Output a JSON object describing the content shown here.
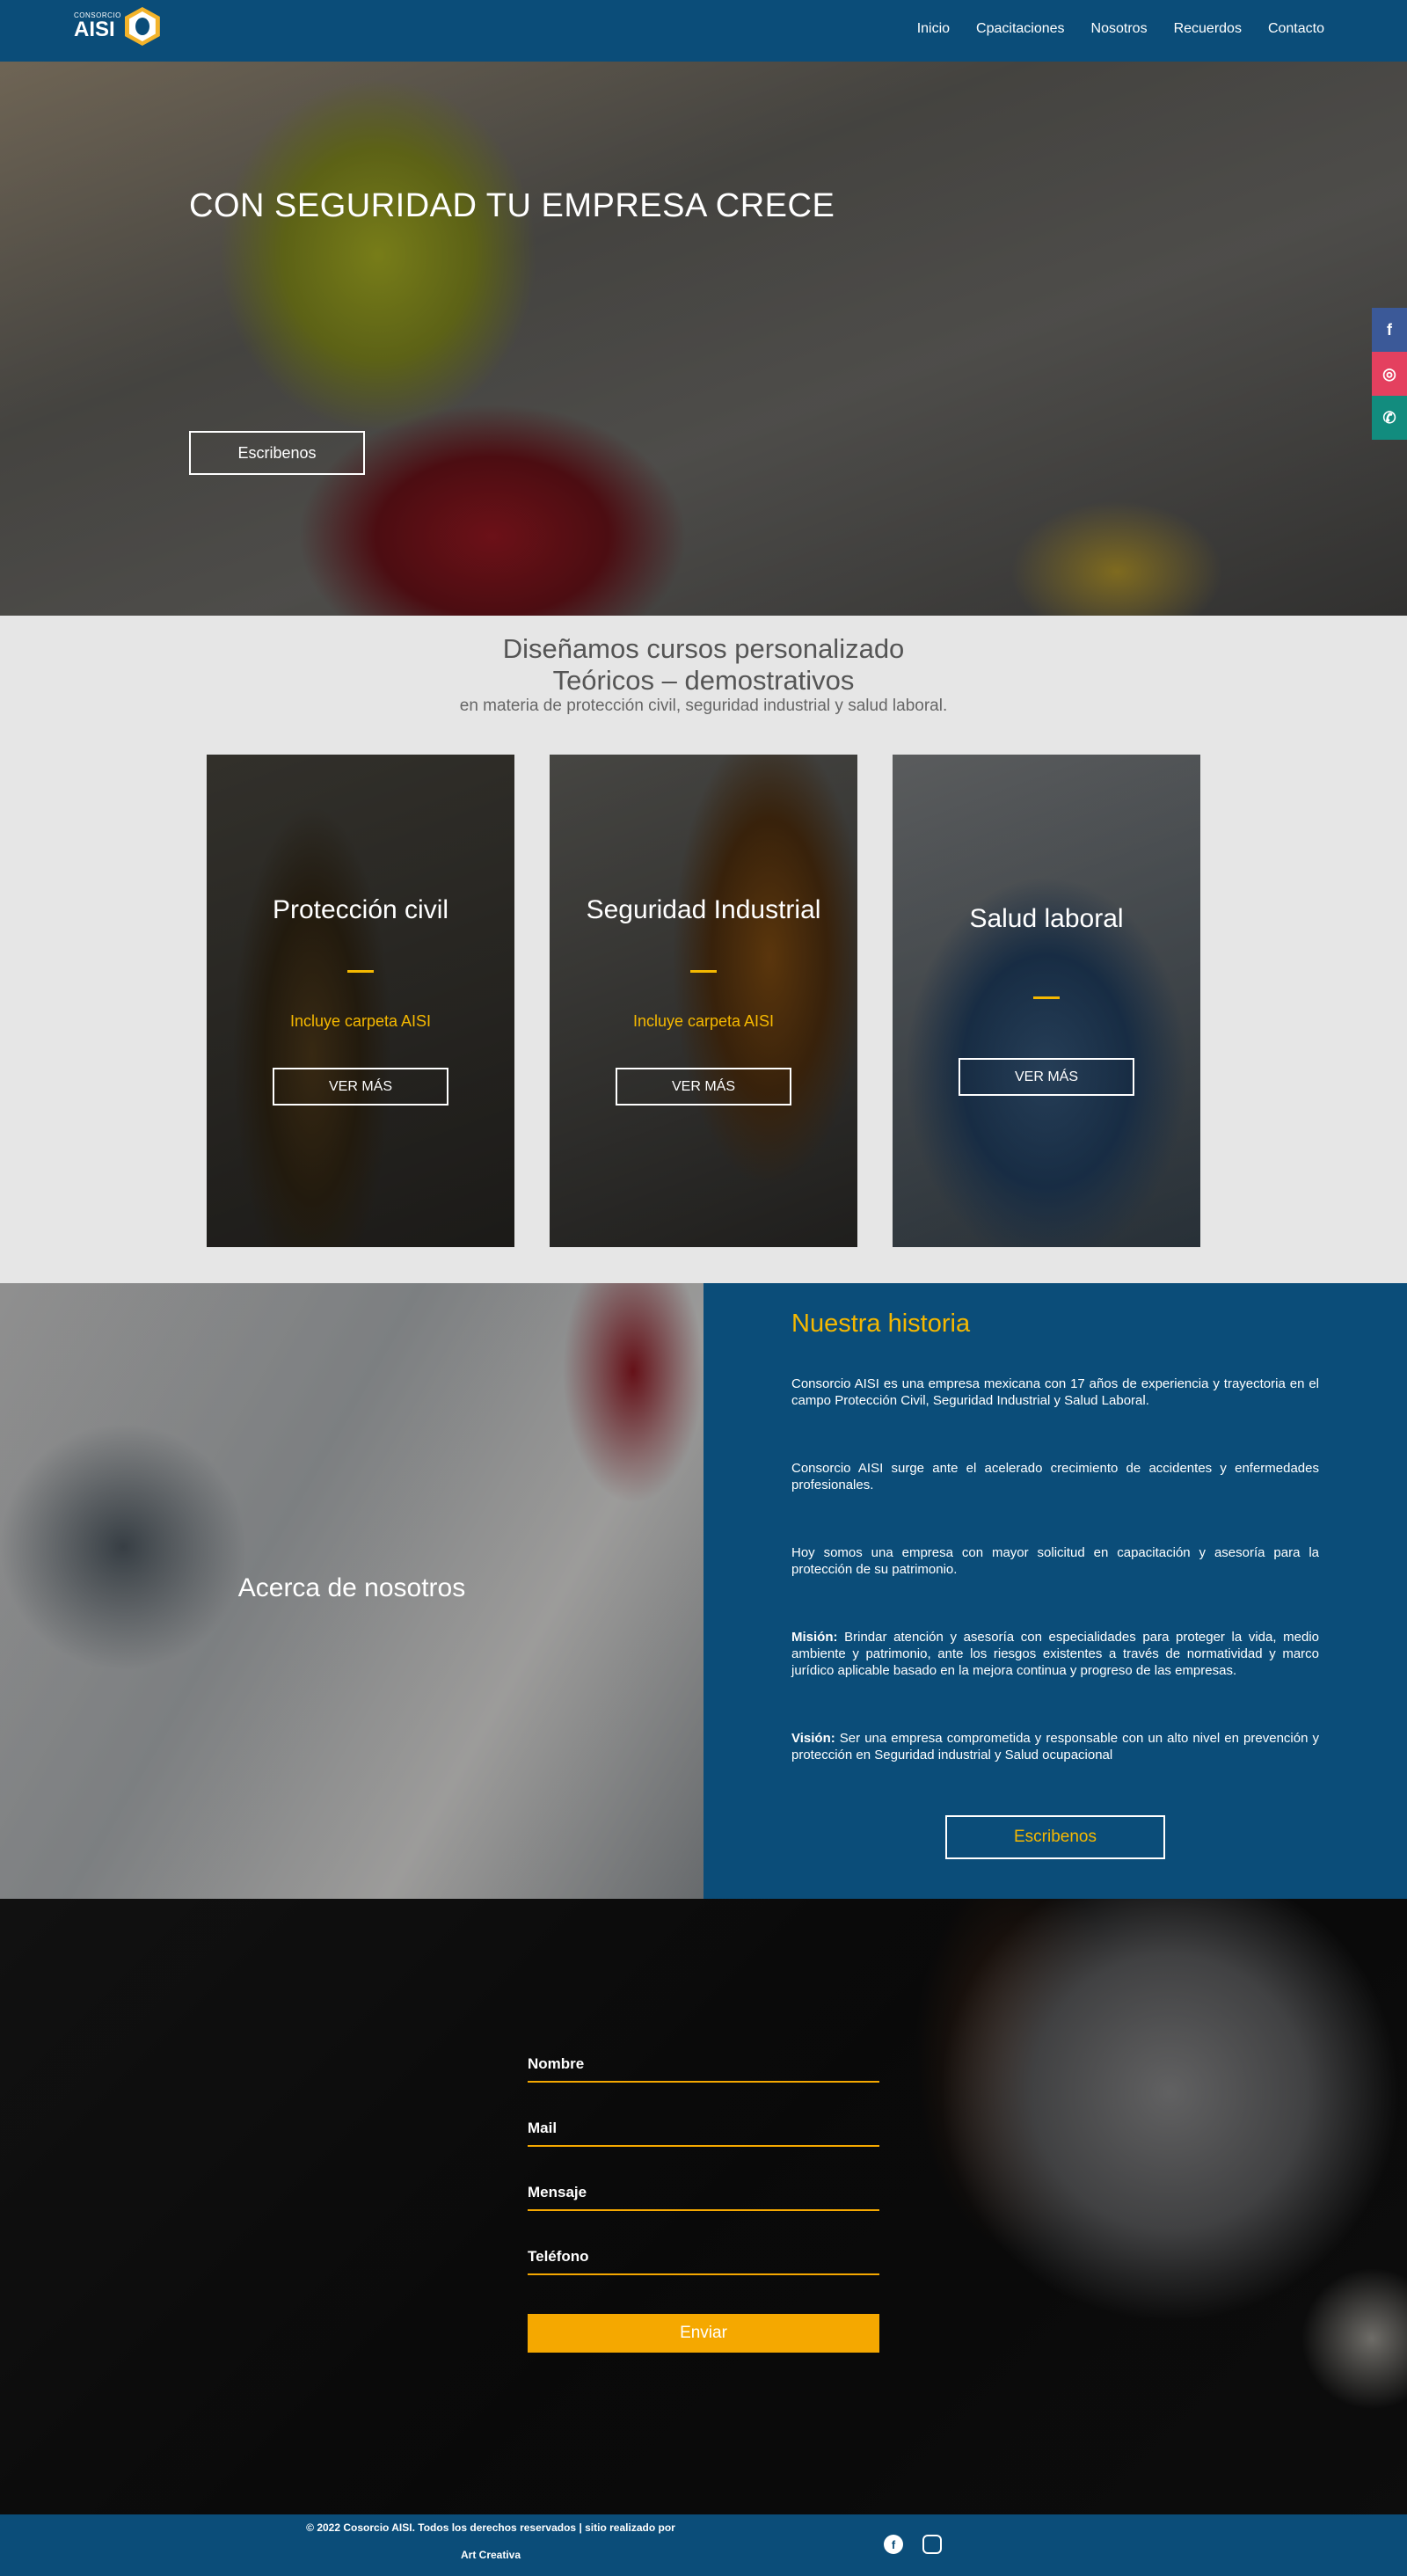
{
  "header": {
    "logo_small": "CONSORCIO",
    "logo_big": "AISI",
    "nav": [
      "Inicio",
      "Cpacitaciones",
      "Nosotros",
      "Recuerdos",
      "Contacto"
    ]
  },
  "hero": {
    "title": "CON SEGURIDAD TU EMPRESA CRECE",
    "button": "Escribenos"
  },
  "social": {
    "icons": [
      "facebook-icon",
      "instagram-icon",
      "whatsapp-icon"
    ],
    "colors": [
      "#3b5998",
      "#e4405f",
      "#128c7e"
    ]
  },
  "courses": {
    "line1": "Diseñamos cursos personalizado",
    "line2": "Teóricos – demostrativos",
    "line3": "en materia de protección civil, seguridad industrial y salud laboral.",
    "cards": [
      {
        "title": "Protección civil",
        "note": "Incluye carpeta AISI",
        "button": "VER MÁS"
      },
      {
        "title": "Seguridad Industrial",
        "note": "Incluye carpeta AISI",
        "button": "VER MÁS"
      },
      {
        "title": "Salud laboral",
        "note": "",
        "button": "VER MÁS"
      }
    ]
  },
  "about": {
    "left_title": "Acerca de nosotros",
    "heading": "Nuestra historia",
    "p1": "Consorcio AISI es una empresa mexicana con 17 años de experiencia y trayectoria en el campo Protección Civil, Seguridad Industrial y Salud Laboral.",
    "p2": "Consorcio AISI surge ante el acelerado crecimiento de accidentes y enfermedades profesionales.",
    "p3": "Hoy somos una empresa con mayor solicitud en capacitación y asesoría para la protección de su patrimonio.",
    "mision_label": "Misión:",
    "mision": " Brindar atención y asesoría con especialidades para proteger la vida, medio ambiente y patrimonio, ante los riesgos existentes a través de normatividad y marco jurídico aplicable basado en la mejora continua y progreso de las empresas.",
    "vision_label": "Visión:",
    "vision": " Ser una empresa comprometida y responsable con un alto nivel en prevención y protección en Seguridad industrial y Salud ocupacional",
    "button": "Escribenos"
  },
  "contact": {
    "fields": [
      "Nombre",
      "Mail",
      "Mensaje",
      "Teléfono"
    ],
    "submit": "Enviar"
  },
  "footer": {
    "copyright": "© 2022 Cosorcio AISI. Todos los derechos reservados | sitio realizado por",
    "credit": "Art Creativa",
    "icons": [
      "facebook-icon",
      "instagram-icon"
    ]
  },
  "colors": {
    "brand_blue": "#0b4d79",
    "accent_yellow": "#f5b800",
    "accent_orange": "#f5a800"
  }
}
